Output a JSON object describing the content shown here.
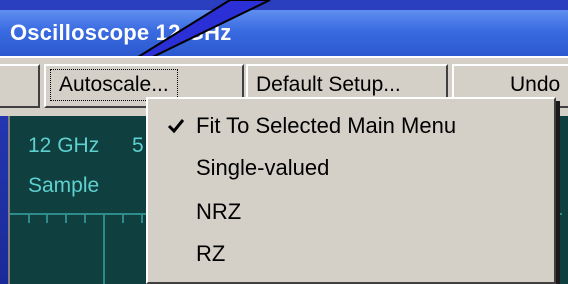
{
  "window": {
    "title": "Oscilloscope 12 GHz"
  },
  "toolbar": {
    "autoscale_label": "Autoscale...",
    "default_setup_label": "Default Setup...",
    "undo_label": "Undo"
  },
  "scope": {
    "freq_label": "12 GHz",
    "freq_suffix": "5",
    "mode_label": "Sample"
  },
  "autoscale_menu": {
    "items": [
      {
        "label": "Fit To Selected Main Menu",
        "checked": true
      },
      {
        "label": "Single-valued",
        "checked": false
      },
      {
        "label": "NRZ",
        "checked": false
      },
      {
        "label": "RZ",
        "checked": false
      }
    ]
  },
  "colors": {
    "title_bar": "#3a6be0",
    "scope_background": "#0f3f3f",
    "scope_text": "#5fd0d0",
    "menu_background": "#d4d0c8"
  }
}
